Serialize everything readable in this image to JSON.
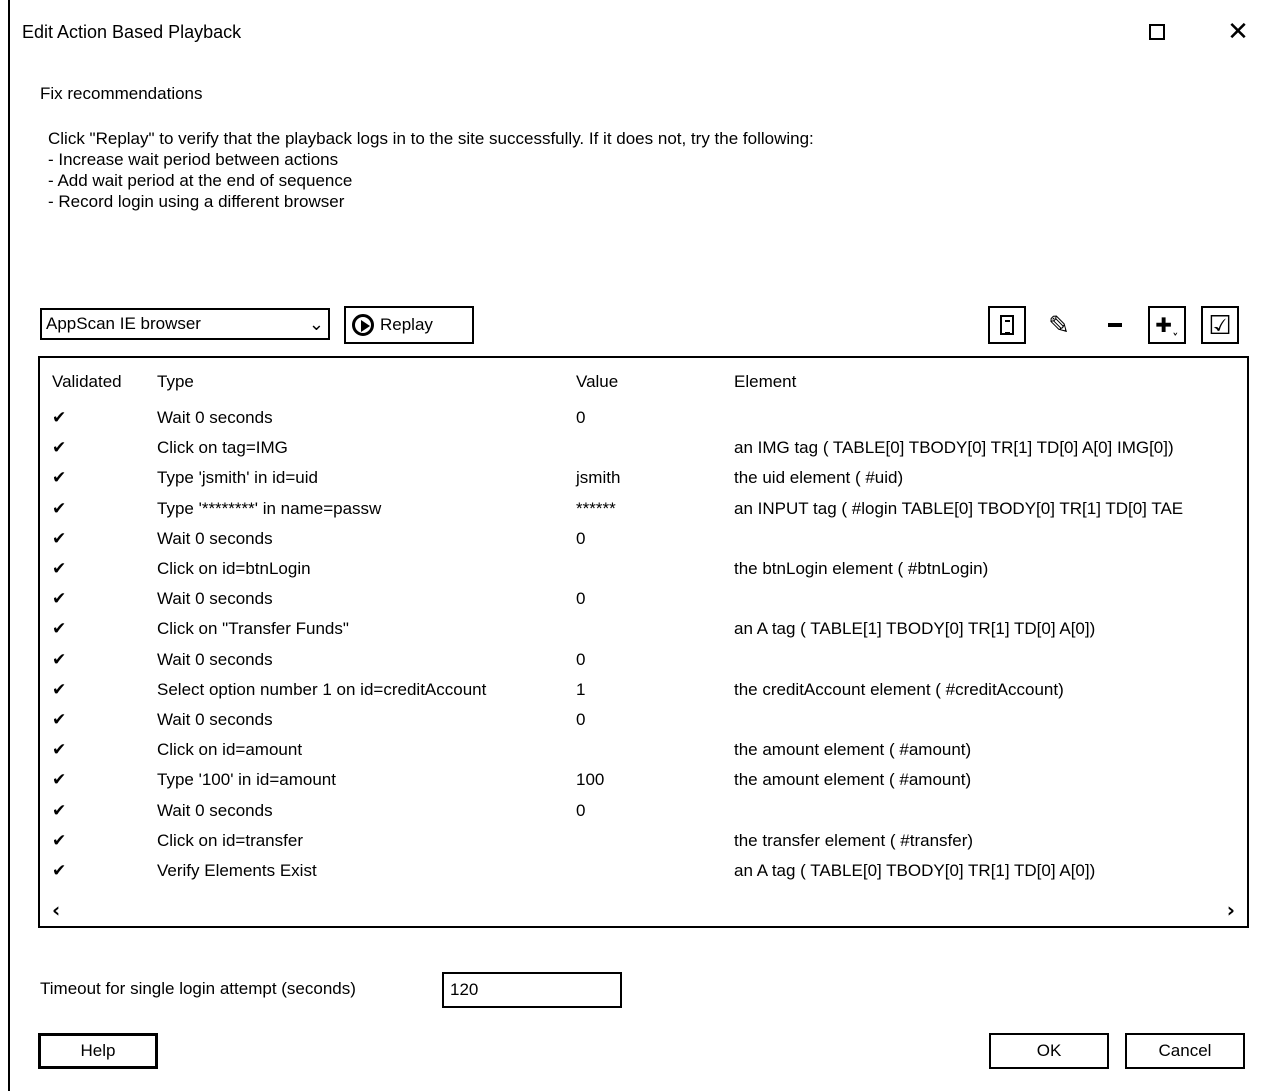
{
  "window": {
    "title": "Edit Action Based Playback",
    "maximize_icon": "maximize-icon",
    "close_symbol": "✕"
  },
  "section_label": "Fix recommendations",
  "instructions": [
    "Click \"Replay\" to verify that the playback logs in to the site successfully. If it does not, try the following:",
    "- Increase wait period between actions",
    "- Add wait period at the end of sequence",
    "- Record login using a different browser"
  ],
  "toolbar": {
    "browser_selected": "AppScan IE browser",
    "dropdown_arrow": "⌄",
    "replay_label": "Replay",
    "icons": [
      "list-icon",
      "edit-icon",
      "remove-icon",
      "add-icon",
      "validate-icon"
    ],
    "pencil": "✎",
    "plus": "✚˯",
    "checkbox": "☑"
  },
  "grid": {
    "headers": {
      "validated": "Validated",
      "type": "Type",
      "value": "Value",
      "element": "Element"
    },
    "check_glyph": "✔",
    "rows": [
      {
        "type": "Wait 0 seconds",
        "value": "0",
        "element": ""
      },
      {
        "type": "Click on tag=IMG",
        "value": "",
        "element": "an IMG tag ( TABLE[0] TBODY[0] TR[1] TD[0] A[0] IMG[0])"
      },
      {
        "type": "Type 'jsmith' in id=uid",
        "value": "jsmith",
        "element": "the uid element ( #uid)"
      },
      {
        "type": "Type '********' in name=passw",
        "value": "******",
        "element": "an INPUT tag ( #login TABLE[0] TBODY[0] TR[1] TD[0] TAE"
      },
      {
        "type": "Wait 0 seconds",
        "value": "0",
        "element": ""
      },
      {
        "type": "Click on id=btnLogin",
        "value": "",
        "element": "the btnLogin element ( #btnLogin)"
      },
      {
        "type": "Wait 0 seconds",
        "value": "0",
        "element": ""
      },
      {
        "type": "Click on \"Transfer Funds\"",
        "value": "",
        "element": "an A tag ( TABLE[1] TBODY[0] TR[1] TD[0] A[0])"
      },
      {
        "type": "Wait 0 seconds",
        "value": "0",
        "element": ""
      },
      {
        "type": "Select option number 1 on id=creditAccount",
        "value": "1",
        "element": "the creditAccount element ( #creditAccount)"
      },
      {
        "type": "Wait 0 seconds",
        "value": "0",
        "element": ""
      },
      {
        "type": "Click on id=amount",
        "value": "",
        "element": "the amount element ( #amount)"
      },
      {
        "type": "Type '100' in id=amount",
        "value": "100",
        "element": "the amount element ( #amount)"
      },
      {
        "type": "Wait 0 seconds",
        "value": "0",
        "element": ""
      },
      {
        "type": "Click on id=transfer",
        "value": "",
        "element": "the transfer element ( #transfer)"
      },
      {
        "type": "Verify Elements Exist",
        "value": "",
        "element": "an A tag ( TABLE[0] TBODY[0] TR[1] TD[0] A[0])"
      }
    ],
    "scroll_left": "‹",
    "scroll_right": "›"
  },
  "timeout": {
    "label": "Timeout for single login attempt (seconds)",
    "value": "120"
  },
  "buttons": {
    "help": "Help",
    "ok": "OK",
    "cancel": "Cancel"
  }
}
